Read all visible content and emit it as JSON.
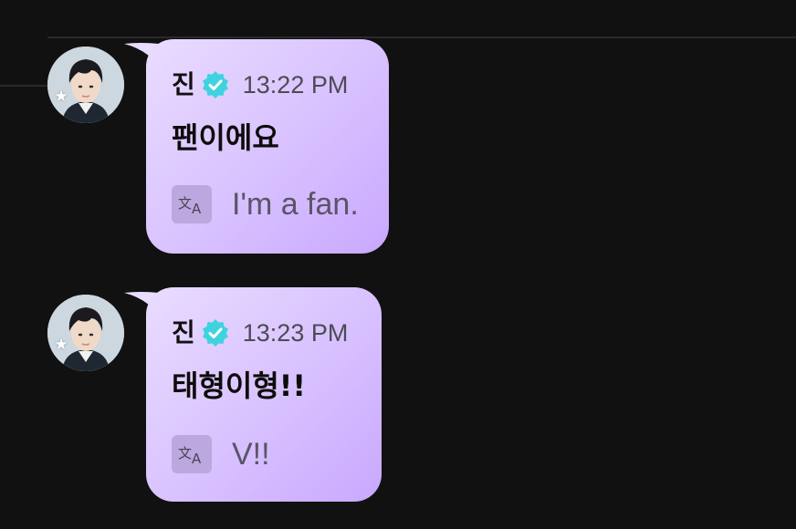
{
  "messages": [
    {
      "sender": "진",
      "time": "13:22 PM",
      "text": "팬이에요",
      "translation": "I'm a fan."
    },
    {
      "sender": "진",
      "time": "13:23 PM",
      "text": "태형이형!!",
      "translation": "V!!"
    }
  ],
  "icons": {
    "verified": "verified-check-icon",
    "translate": "translate-icon",
    "star": "star-icon"
  },
  "colors": {
    "background": "#111112",
    "bubble_start": "#e9dcff",
    "bubble_end": "#c9a8ff",
    "verified": "#3fd3e0"
  }
}
